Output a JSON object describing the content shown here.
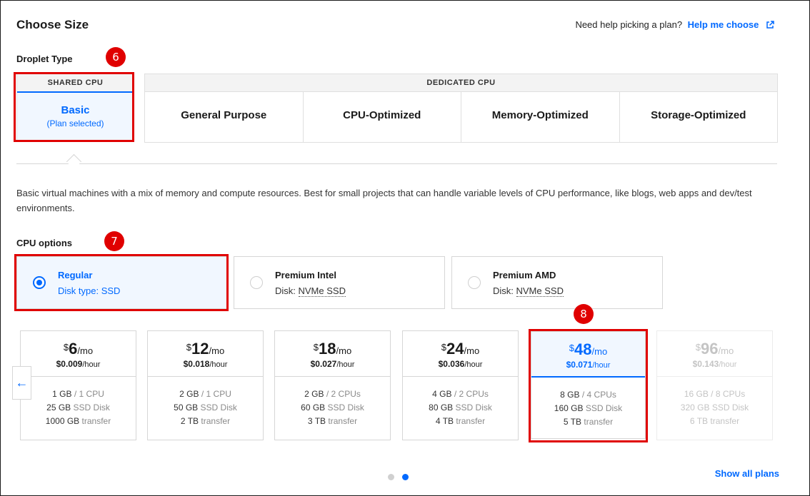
{
  "header": {
    "title": "Choose Size",
    "help_text": "Need help picking a plan?",
    "help_link": "Help me choose"
  },
  "droplet_type": {
    "label": "Droplet Type",
    "shared": {
      "header": "SHARED CPU",
      "option": "Basic",
      "note": "(Plan selected)"
    },
    "dedicated": {
      "header": "DEDICATED CPU",
      "options": [
        "General Purpose",
        "CPU-Optimized",
        "Memory-Optimized",
        "Storage-Optimized"
      ]
    }
  },
  "description": "Basic virtual machines with a mix of memory and compute resources. Best for small projects that can handle variable levels of CPU performance, like blogs, web apps and dev/test environments.",
  "cpu_options": {
    "label": "CPU options",
    "items": [
      {
        "name": "Regular",
        "disk_prefix": "Disk type: ",
        "disk": "SSD",
        "selected": true
      },
      {
        "name": "Premium Intel",
        "disk_prefix": "Disk: ",
        "disk": "NVMe SSD",
        "selected": false
      },
      {
        "name": "Premium AMD",
        "disk_prefix": "Disk: ",
        "disk": "NVMe SSD",
        "selected": false
      }
    ]
  },
  "plans": [
    {
      "currency": "$",
      "price": "6",
      "period": "/mo",
      "hourly": "$0.009",
      "hourly_unit": "/hour",
      "ram": "1 GB",
      "cpu": "1 CPU",
      "disk": "25 GB",
      "disk_label": "SSD Disk",
      "transfer": "1000 GB",
      "transfer_label": "transfer"
    },
    {
      "currency": "$",
      "price": "12",
      "period": "/mo",
      "hourly": "$0.018",
      "hourly_unit": "/hour",
      "ram": "2 GB",
      "cpu": "1 CPU",
      "disk": "50 GB",
      "disk_label": "SSD Disk",
      "transfer": "2 TB",
      "transfer_label": "transfer"
    },
    {
      "currency": "$",
      "price": "18",
      "period": "/mo",
      "hourly": "$0.027",
      "hourly_unit": "/hour",
      "ram": "2 GB",
      "cpu": "2 CPUs",
      "disk": "60 GB",
      "disk_label": "SSD Disk",
      "transfer": "3 TB",
      "transfer_label": "transfer"
    },
    {
      "currency": "$",
      "price": "24",
      "period": "/mo",
      "hourly": "$0.036",
      "hourly_unit": "/hour",
      "ram": "4 GB",
      "cpu": "2 CPUs",
      "disk": "80 GB",
      "disk_label": "SSD Disk",
      "transfer": "4 TB",
      "transfer_label": "transfer"
    },
    {
      "currency": "$",
      "price": "48",
      "period": "/mo",
      "hourly": "$0.071",
      "hourly_unit": "/hour",
      "ram": "8 GB",
      "cpu": "4 CPUs",
      "disk": "160 GB",
      "disk_label": "SSD Disk",
      "transfer": "5 TB",
      "transfer_label": "transfer"
    },
    {
      "currency": "$",
      "price": "96",
      "period": "/mo",
      "hourly": "$0.143",
      "hourly_unit": "/hour",
      "ram": "16 GB",
      "cpu": "8 CPUs",
      "disk": "320 GB",
      "disk_label": "SSD Disk",
      "transfer": "6 TB",
      "transfer_label": "transfer"
    }
  ],
  "annotations": [
    "6",
    "7",
    "8"
  ],
  "nav": {
    "prev_arrow": "←",
    "show_all": "Show all plans"
  },
  "icons": {
    "external_link": "external-link-icon",
    "prev": "arrow-left-icon"
  },
  "colors": {
    "accent": "#0069ff",
    "annotation": "#e00000",
    "selected_bg": "#f1f7ff"
  }
}
